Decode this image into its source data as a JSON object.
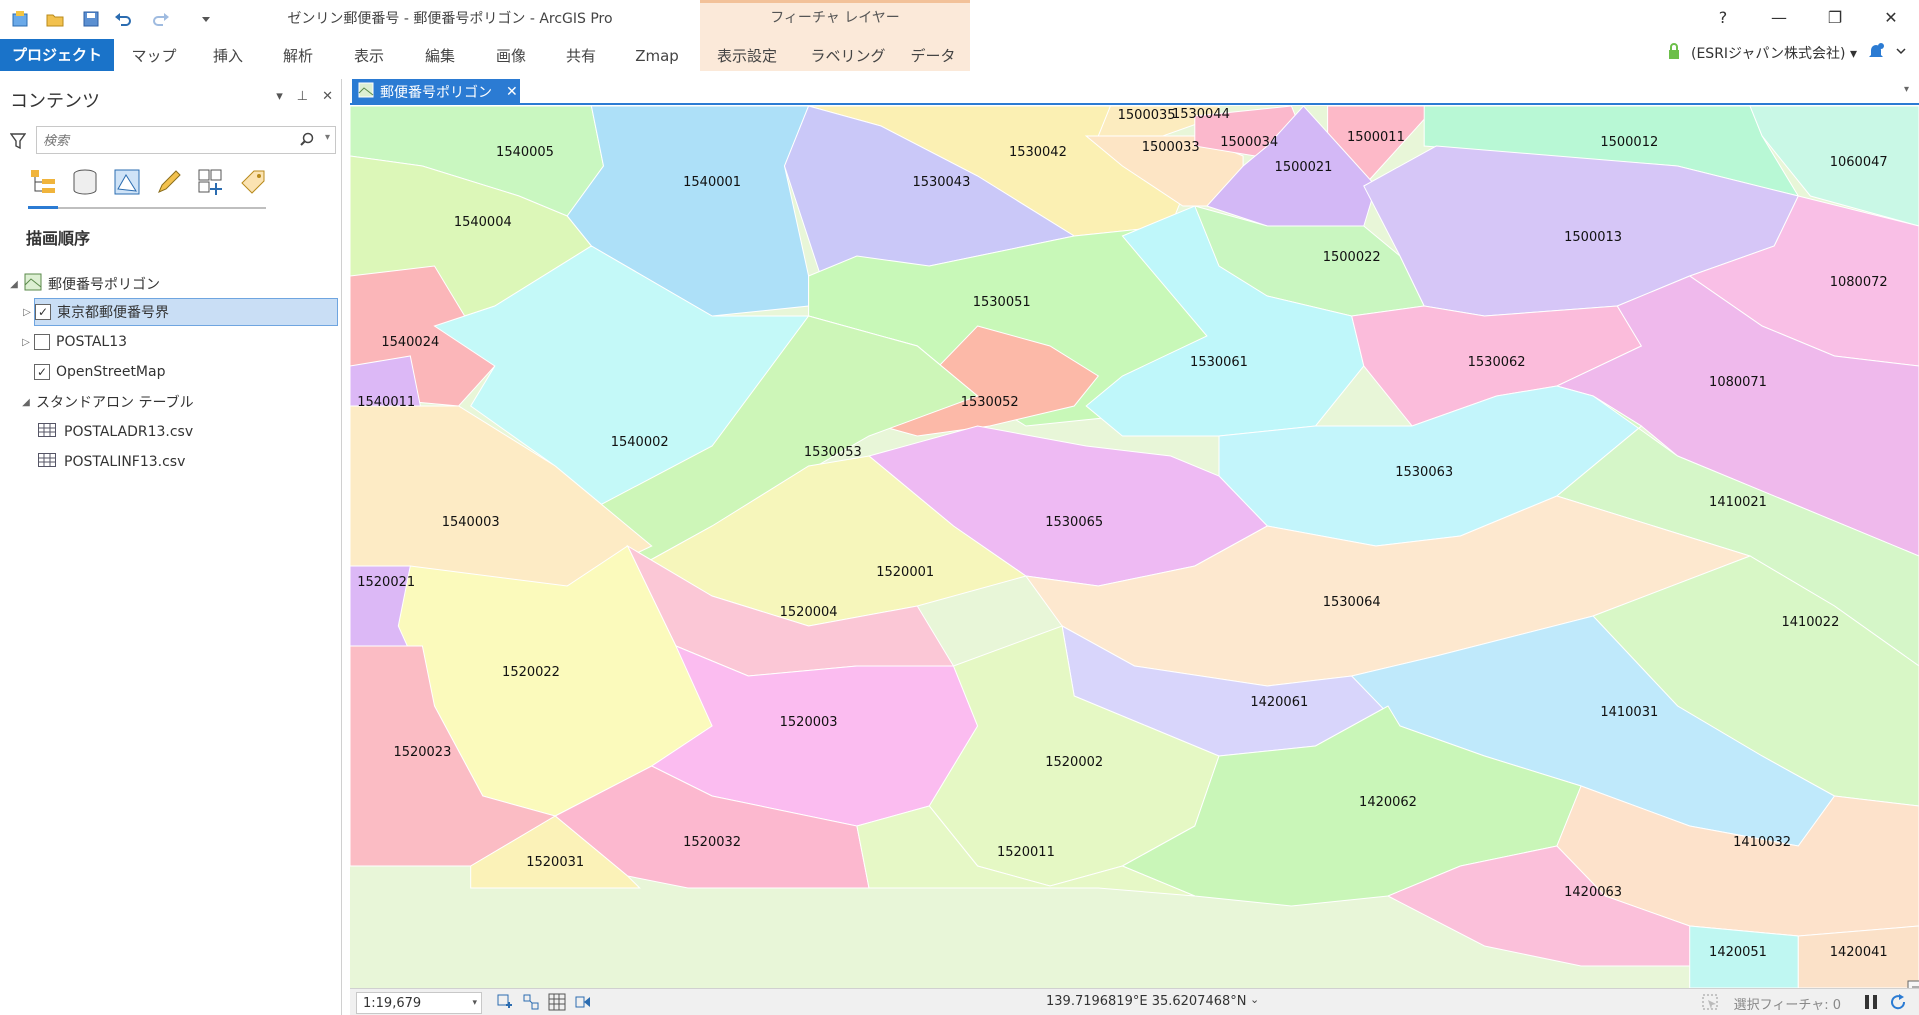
{
  "window": {
    "title": "ゼンリン郵便番号 - 郵便番号ポリゴン - ArcGIS Pro",
    "contextual_group": "フィーチャ レイヤー",
    "help": "?",
    "minimize": "—",
    "restore": "❐",
    "close": "✕"
  },
  "ribbon": {
    "tabs": [
      {
        "label": "プロジェクト"
      },
      {
        "label": "マップ"
      },
      {
        "label": "挿入"
      },
      {
        "label": "解析"
      },
      {
        "label": "表示"
      },
      {
        "label": "編集"
      },
      {
        "label": "画像"
      },
      {
        "label": "共有"
      },
      {
        "label": "Zmap"
      },
      {
        "label": "表示設定"
      },
      {
        "label": "ラベリング"
      },
      {
        "label": "データ"
      }
    ],
    "user": "(ESRIジャパン株式会社) ▾"
  },
  "contents": {
    "title": "コンテンツ",
    "search_placeholder": "検索",
    "section": "描画順序",
    "map_name": "郵便番号ポリゴン",
    "layers": [
      {
        "label": "東京都郵便番号界",
        "checked": true,
        "selected": true
      },
      {
        "label": "POSTAL13",
        "checked": false,
        "selected": false
      },
      {
        "label": "OpenStreetMap",
        "checked": true,
        "selected": false
      }
    ],
    "standalone_header": "スタンドアロン テーブル",
    "tables": [
      {
        "label": "POSTALADR13.csv"
      },
      {
        "label": "POSTALINF13.csv"
      }
    ]
  },
  "map_view": {
    "tab_label": "郵便番号ポリゴン",
    "polygons": [
      {
        "code": "1530044",
        "color": "#cfd0fb"
      },
      {
        "code": "1500035",
        "color": "#fcecbf"
      },
      {
        "code": "1540005",
        "color": "#c9f7c0"
      },
      {
        "code": "1540001",
        "color": "#ade0f8"
      },
      {
        "code": "1530042",
        "color": "#fbf0b3"
      },
      {
        "code": "1500033",
        "color": "#fde5c5"
      },
      {
        "code": "1500034",
        "color": "#fbb8cc"
      },
      {
        "code": "1500011",
        "color": "#fdb9c8"
      },
      {
        "code": "1500012",
        "color": "#b8f8d5"
      },
      {
        "code": "1060047",
        "color": "#c9f8e6"
      },
      {
        "code": "1530043",
        "color": "#cac8f8"
      },
      {
        "code": "1500021",
        "color": "#d3b8f6"
      },
      {
        "code": "1540004",
        "color": "#dcf7b8"
      },
      {
        "code": "1500022",
        "color": "#c9f6c0"
      },
      {
        "code": "1500013",
        "color": "#d6c6f7"
      },
      {
        "code": "1530051",
        "color": "#c8f8b8"
      },
      {
        "code": "1080072",
        "color": "#f9bfe6"
      },
      {
        "code": "1540024",
        "color": "#fbb6b9"
      },
      {
        "code": "1530061",
        "color": "#bff7fa"
      },
      {
        "code": "1530062",
        "color": "#fbbcdb"
      },
      {
        "code": "1080071",
        "color": "#efb9ec"
      },
      {
        "code": "1540011",
        "color": "#dcb8f6"
      },
      {
        "code": "1530052",
        "color": "#fcb9a8"
      },
      {
        "code": "1540002",
        "color": "#c4f9f8"
      },
      {
        "code": "1530053",
        "color": "#cdf6b8"
      },
      {
        "code": "1530063",
        "color": "#c3f5fb"
      },
      {
        "code": "1410021",
        "color": "#d5f6c8"
      },
      {
        "code": "1540003",
        "color": "#fdebc5"
      },
      {
        "code": "1530065",
        "color": "#eebaf3"
      },
      {
        "code": "1520001",
        "color": "#f6f6bb"
      },
      {
        "code": "1520021",
        "color": "#dcb8f6"
      },
      {
        "code": "1520004",
        "color": "#fbc7d6"
      },
      {
        "code": "1530064",
        "color": "#fde8cf"
      },
      {
        "code": "1410022",
        "color": "#d8f7c6"
      },
      {
        "code": "1420061",
        "color": "#d8d5fb"
      },
      {
        "code": "1410031",
        "color": "#bfe9fb"
      },
      {
        "code": "1520022",
        "color": "#fbfabc"
      },
      {
        "code": "1520003",
        "color": "#fbbcf0"
      },
      {
        "code": "1520002",
        "color": "#e5f8c4"
      },
      {
        "code": "1520023",
        "color": "#fbbcc4"
      },
      {
        "code": "1420062",
        "color": "#c9f6b8"
      },
      {
        "code": "1410032",
        "color": "#fde2cb"
      },
      {
        "code": "1420063",
        "color": "#fbc0da"
      },
      {
        "code": "1520032",
        "color": "#fcb8cf"
      },
      {
        "code": "1520031",
        "color": "#fbf2b8"
      },
      {
        "code": "1520011",
        "color": "#e6f8c6"
      },
      {
        "code": "1420051",
        "color": "#bff7f2"
      },
      {
        "code": "1420041",
        "color": "#fbe1c8"
      }
    ]
  },
  "status": {
    "scale": "1:19,679",
    "coordinates": "139.7196819°E 35.6207468°N",
    "selected_features": "選択フィーチャ: 0"
  },
  "colors": {
    "accent": "#1a73c9",
    "contextual": "#fbe9d9",
    "selection": "#c9def5"
  }
}
